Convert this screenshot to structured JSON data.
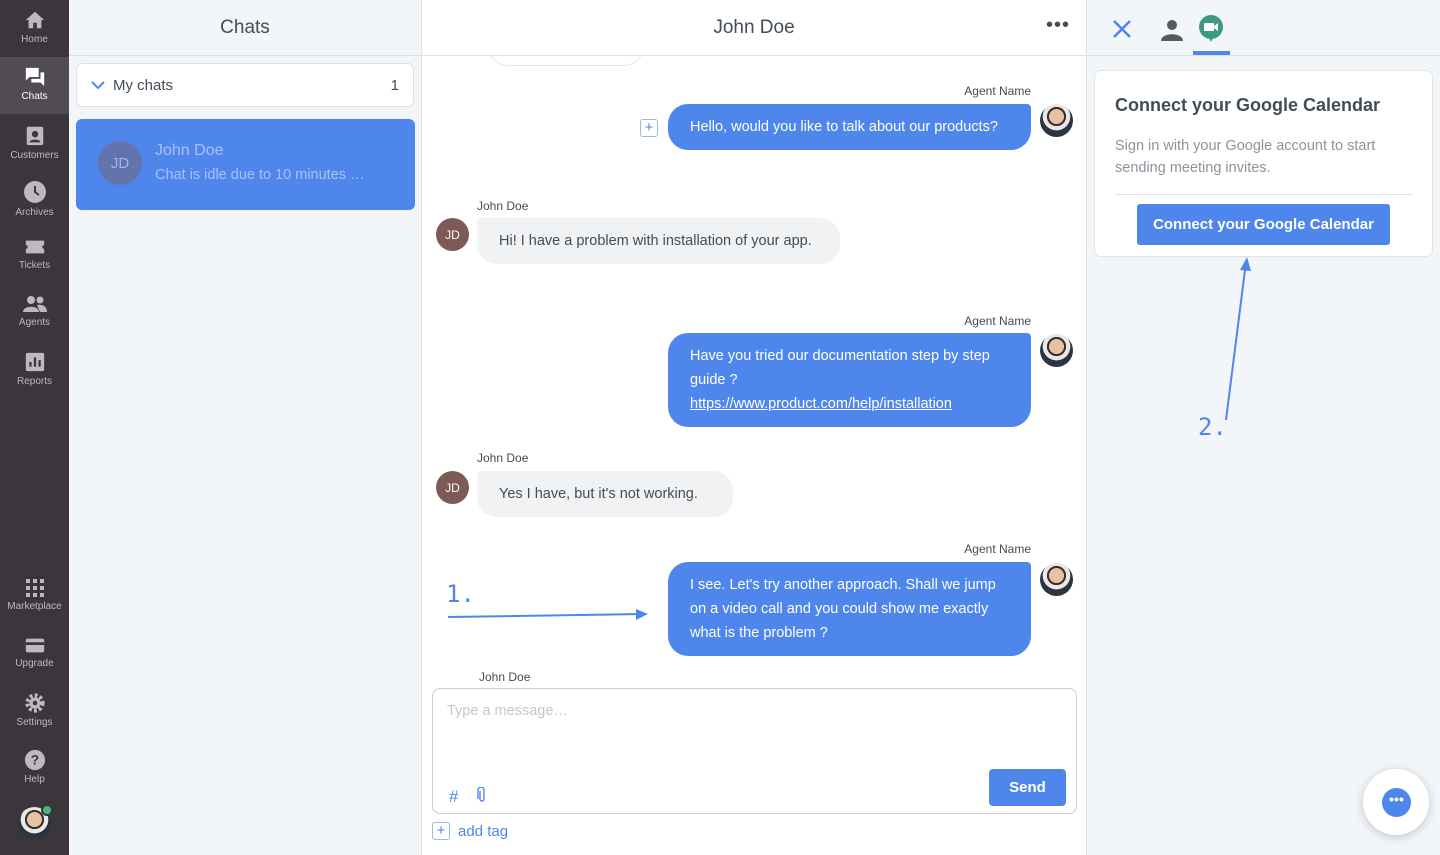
{
  "nav": {
    "items": [
      {
        "label": "Home",
        "icon": "home-icon"
      },
      {
        "label": "Chats",
        "icon": "chats-icon",
        "active": true
      },
      {
        "label": "Customers",
        "icon": "customers-icon"
      },
      {
        "label": "Archives",
        "icon": "clock-icon"
      },
      {
        "label": "Tickets",
        "icon": "ticket-icon"
      },
      {
        "label": "Agents",
        "icon": "agents-icon"
      },
      {
        "label": "Reports",
        "icon": "reports-icon"
      }
    ],
    "bottom": [
      {
        "label": "Marketplace",
        "icon": "grid-icon"
      },
      {
        "label": "Upgrade",
        "icon": "card-icon"
      },
      {
        "label": "Settings",
        "icon": "gear-icon"
      },
      {
        "label": "Help",
        "icon": "help-icon"
      }
    ]
  },
  "list": {
    "title": "Chats",
    "group": {
      "label": "My chats",
      "count": "1"
    },
    "chat": {
      "initials": "JD",
      "name": "John Doe",
      "preview": "Chat is idle due to 10 minutes …"
    }
  },
  "main": {
    "title": "John Doe",
    "messages": [
      {
        "from": "agent",
        "sender": "Agent Name",
        "text": "Hello, would you like to talk about our products?"
      },
      {
        "from": "customer",
        "sender": "John Doe",
        "initials": "JD",
        "text": "Hi! I have a problem with installation of your app."
      },
      {
        "from": "agent",
        "sender": "Agent Name",
        "text": "Have you tried our documentation step by step guide ?",
        "link": "https://www.product.com/help/installation"
      },
      {
        "from": "customer",
        "sender": "John Doe",
        "initials": "JD",
        "text": "Yes I have, but it's not working."
      },
      {
        "from": "agent",
        "sender": "Agent Name",
        "text": "I see. Let's try another approach. Shall we jump on a video call and you could show me exactly what is the problem ?"
      },
      {
        "from": "customer",
        "sender": "John Doe"
      }
    ],
    "composer": {
      "placeholder": "Type a message…",
      "send": "Send",
      "add_tag": "add tag"
    }
  },
  "right": {
    "card": {
      "title": "Connect your Google Calendar",
      "text": "Sign in with your Google account to start sending meeting invites.",
      "button": "Connect your Google Calendar"
    }
  },
  "annotations": {
    "one": "1.",
    "two": "2."
  },
  "colors": {
    "accent": "#4f86ec",
    "nav": "#3a363c",
    "meet": "#3c9a7f"
  }
}
